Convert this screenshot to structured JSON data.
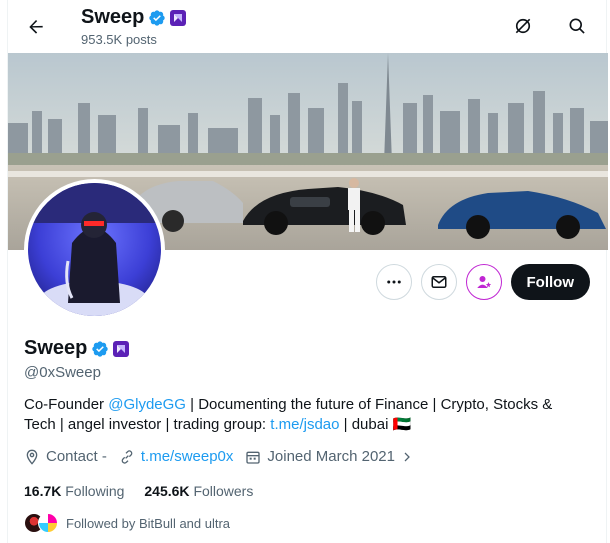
{
  "header": {
    "name": "Sweep",
    "posts": "953.5K posts"
  },
  "profile": {
    "name": "Sweep",
    "handle": "@0xSweep",
    "bio_prefix": "Co-Founder ",
    "bio_mention": "@GlydeGG",
    "bio_mid": " | Documenting the future of Finance | Crypto, Stocks & Tech | angel investor | trading group: ",
    "bio_link": "t.me/jsdao",
    "bio_suffix": " | dubai 🇦🇪",
    "contact": "Contact -",
    "website": "t.me/sweep0x",
    "joined": "Joined March 2021"
  },
  "actions": {
    "follow_label": "Follow"
  },
  "stats": {
    "following_count": "16.7K",
    "following_label": "Following",
    "followers_count": "245.6K",
    "followers_label": "Followers"
  },
  "followed_by": "Followed by BitBull and ultra",
  "colors": {
    "accent": "#1d9bf0",
    "verified": "#1d9bf0",
    "subscribe": "#c026d3",
    "affiliate_badge": "#5b21b6"
  },
  "icons": [
    "back-arrow-icon",
    "grok-icon",
    "search-icon",
    "verified-icon",
    "affiliate-badge-icon",
    "more-icon",
    "message-icon",
    "subscribe-icon",
    "location-icon",
    "link-icon",
    "calendar-icon"
  ]
}
